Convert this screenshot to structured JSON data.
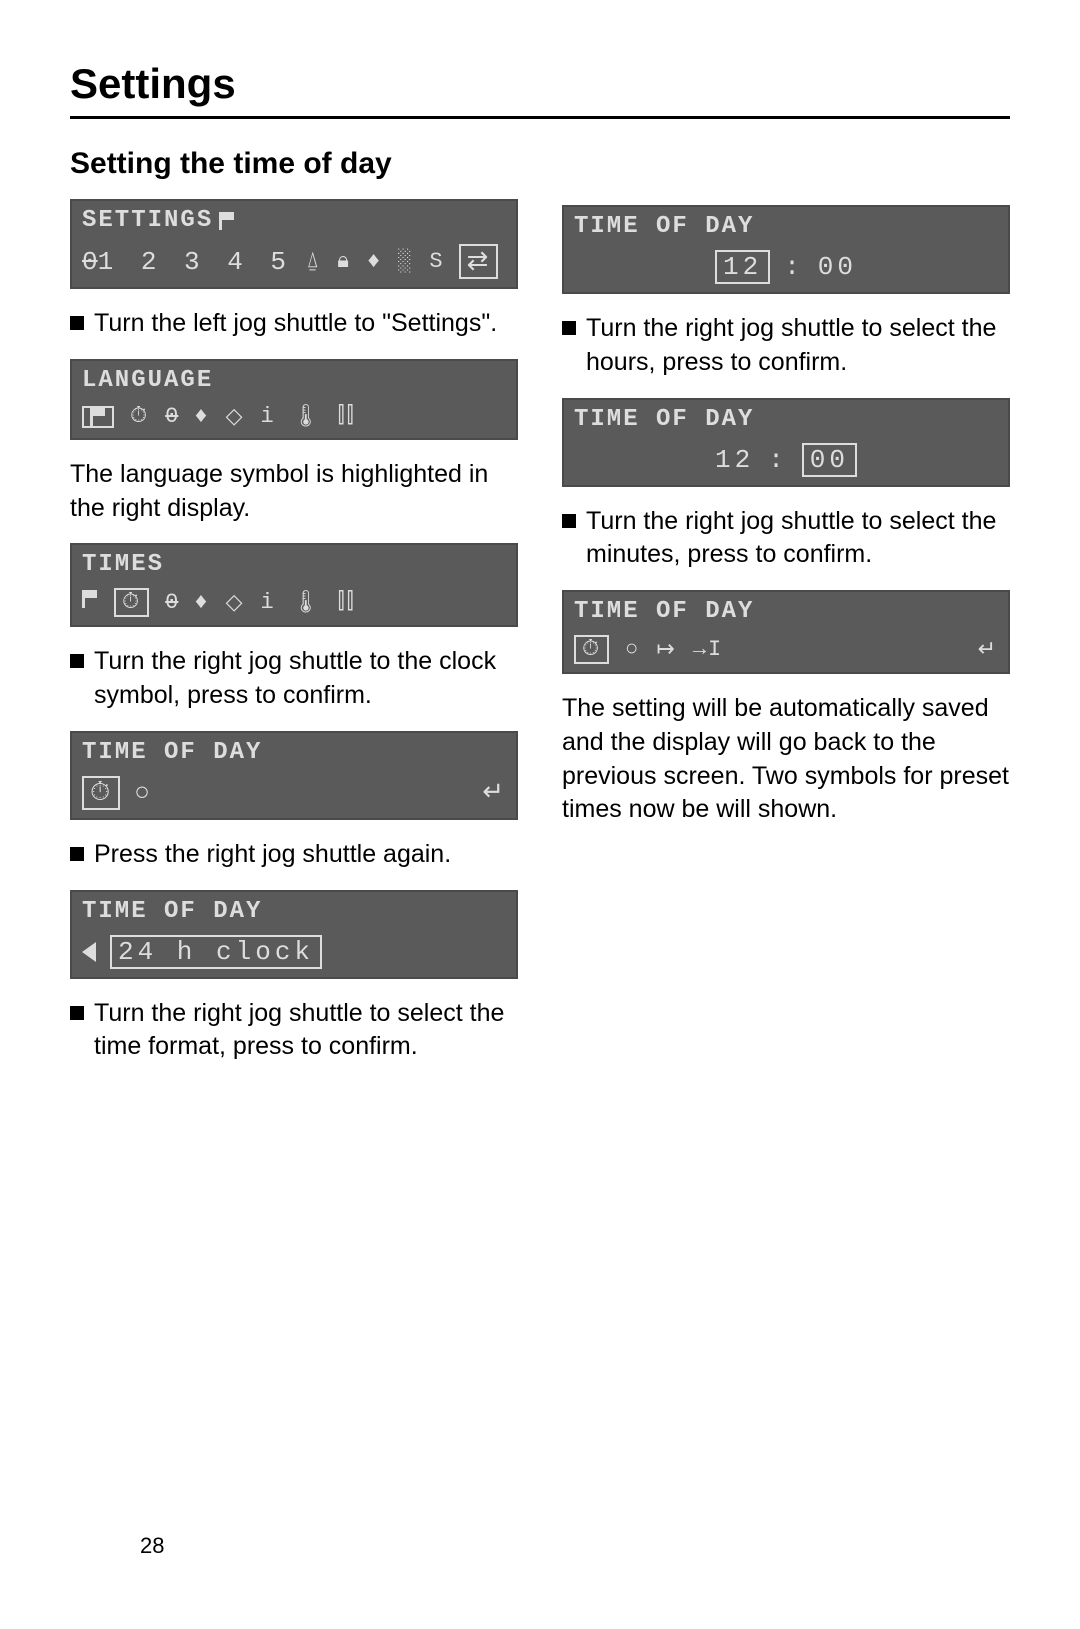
{
  "page_title": "Settings",
  "subheading": "Setting the time of day",
  "page_number": "28",
  "left": {
    "display1": {
      "header": "SETTINGS",
      "body_numbers": "1 2 3 4 5",
      "body_zero": "0"
    },
    "instr1": "Turn the left jog shuttle to \"Settings\".",
    "display2": {
      "header": "LANGUAGE"
    },
    "text2": "The language symbol is highlighted in the right display.",
    "display3": {
      "header": "TIMES"
    },
    "instr3": "Turn the right jog shuttle to the clock symbol, press to confirm.",
    "display4": {
      "header": "TIME OF DAY"
    },
    "instr4": "Press the right jog shuttle again.",
    "display5": {
      "header": "TIME OF DAY",
      "value": "24 h clock"
    },
    "instr5": "Turn the right jog shuttle to select the time format, press to confirm."
  },
  "right": {
    "display1": {
      "header": "TIME OF DAY",
      "hours": "12",
      "sep": ":",
      "mins": "00"
    },
    "instr1": "Turn the right jog shuttle to select the hours, press to confirm.",
    "display2": {
      "header": "TIME OF DAY",
      "hours": "12",
      "sep": ":",
      "mins": "00"
    },
    "instr2": "Turn the right jog shuttle to select the minutes, press to confirm.",
    "display3": {
      "header": "TIME OF DAY"
    },
    "text3": "The setting will be automatically saved and the display will go back to the previous screen. Two symbols for preset times now be will shown."
  }
}
